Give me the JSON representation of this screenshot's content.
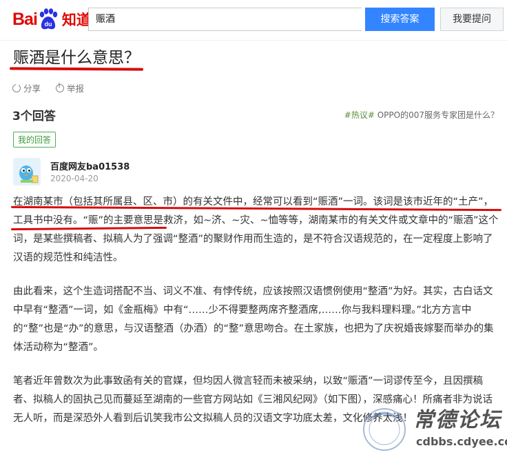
{
  "header": {
    "logo_bai": "Bai",
    "logo_du": "du",
    "logo_zhidao": "知道",
    "search_value": "赈酒",
    "search_button": "搜索答案",
    "ask_button": "我要提问"
  },
  "question": {
    "title": "赈酒是什么意思？",
    "share": "分享",
    "report": "举报"
  },
  "answers": {
    "count_label": "3个回答",
    "hot_prefix": "#热议#",
    "hot_text": " OPPO的007服务专家团是什么？",
    "mine_badge": "我的回答",
    "user": "百度网友ba01538",
    "date": "2020-04-20",
    "p1": "在湖南某市（包括其所属县、区、市）的有关文件中，经常可以看到“赈酒”一词。该词是该市近年的“土产”，工具书中没有。“赈”的主要意思是救济，如~济、~灾、~恤等等，湖南某市的有关文件或文章中的“赈酒”这个词，是某些撰稿者、拟稿人为了强调“整酒”的聚财作用而生造的，是不符合汉语规范的，在一定程度上影响了汉语的规范性和纯洁性。",
    "p2": "由此看来，这个生造词搭配不当、词义不准、有悖传统，应该按照汉语惯例使用“整酒”为好。其实，古白话文中早有“整酒”一词，如《金瓶梅》中有“……少不得要整两席齐整酒席,……你与我料理料理。”北方方言中的“整”也是“办”的意思，与汉语整酒（办酒）的“整”意思吻合。在土家族，也把为了庆祝婚丧嫁娶而举办的集体活动称为“整酒”。",
    "p3": "笔者近年曾数次为此事致函有关的官媒，但均因人微言轻而未被采纳，以致“赈酒”一词谬传至今，且因撰稿者、拟稿人的固执己见而蔓延至湖南的一些官方网站如《三湘风纪网》（如下图），深感痛心！所痛者非为说话无人听，而是深恐外人看到后讥笑我市公文拟稿人员的汉语文字功底太差，文化修养太浅！"
  },
  "watermark": {
    "text": "常德论坛",
    "url": "cdbbs.cdyee.com"
  },
  "colors": {
    "baidu_red": "#e10602",
    "search_blue": "#3385ff",
    "underline_red": "#d80c0c",
    "badge_green": "#4caf50"
  }
}
